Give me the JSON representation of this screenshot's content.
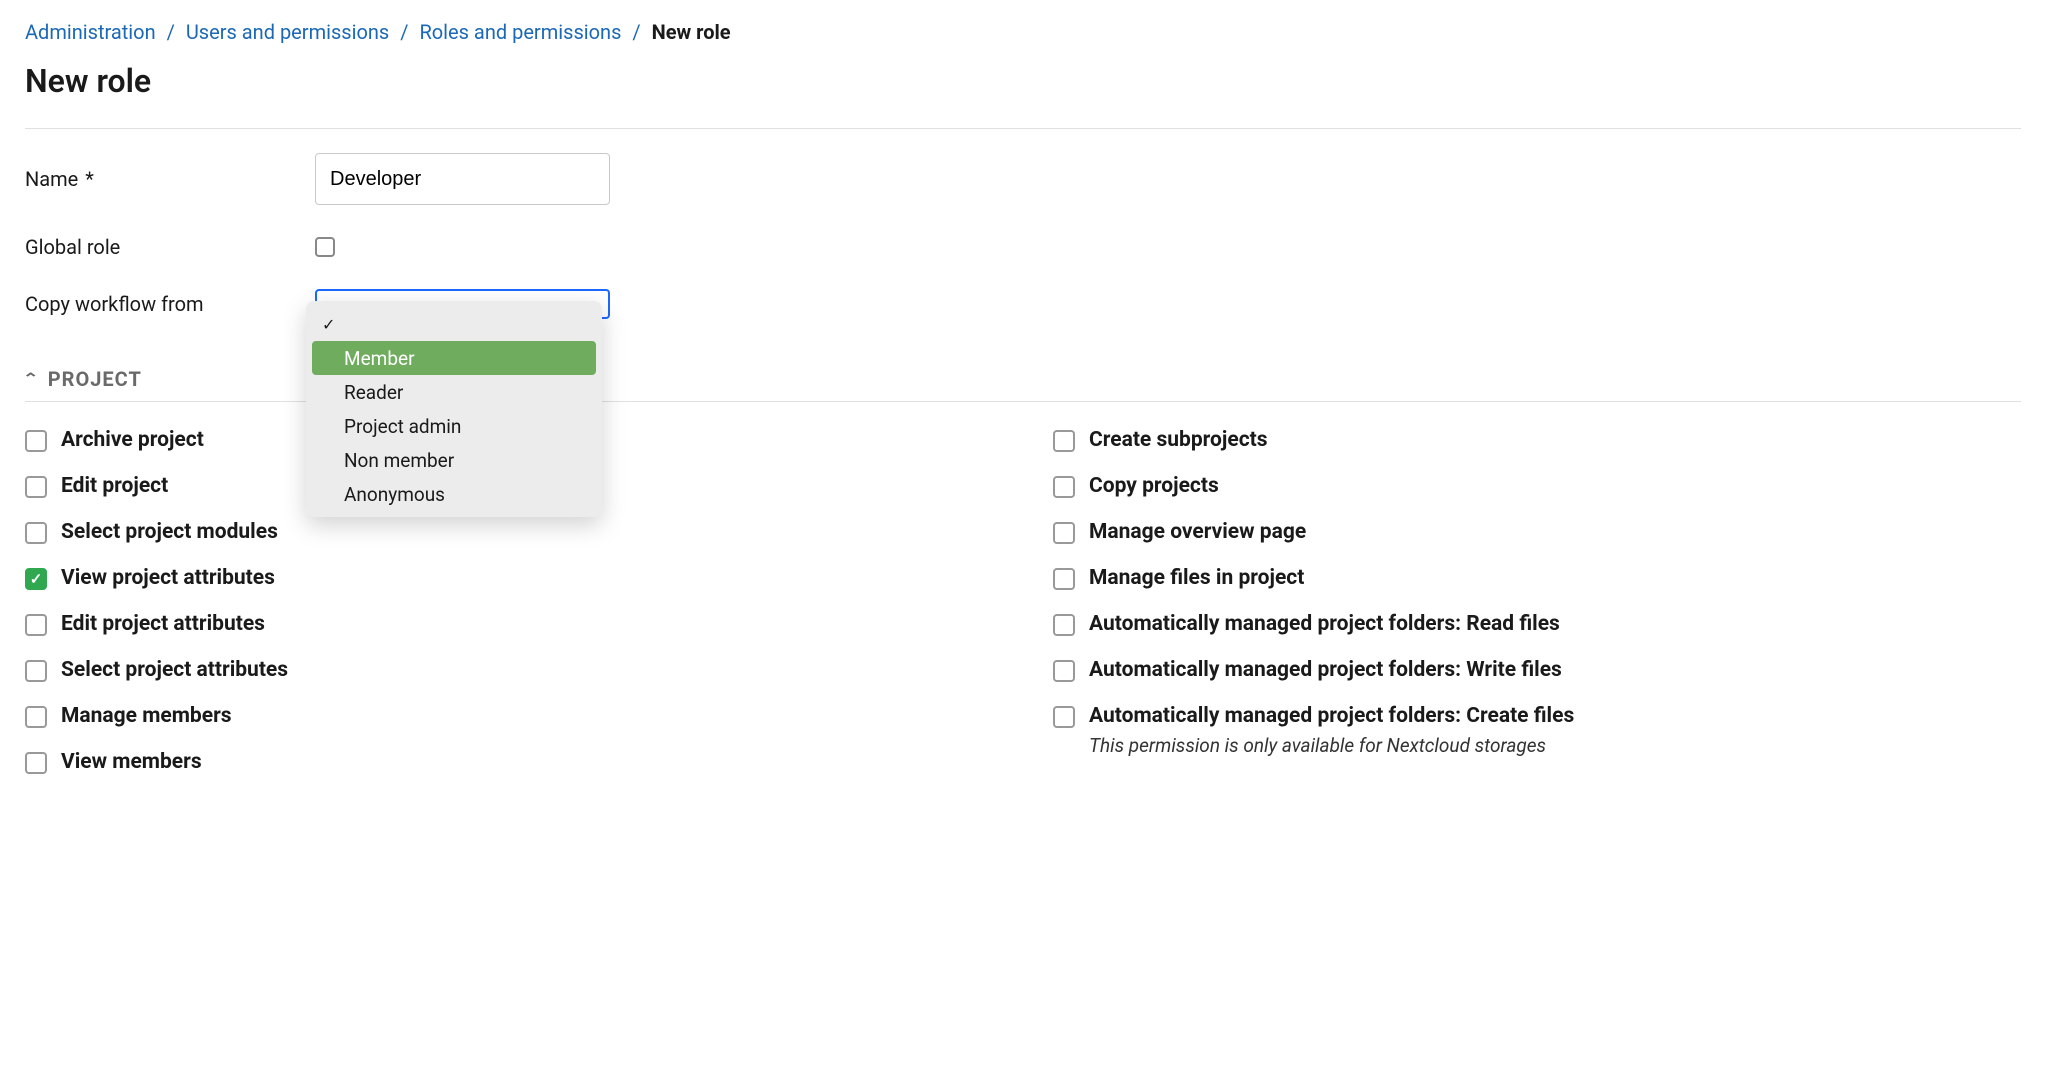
{
  "breadcrumb": {
    "items": [
      {
        "label": "Administration"
      },
      {
        "label": "Users and permissions"
      },
      {
        "label": "Roles and permissions"
      }
    ],
    "current": "New role"
  },
  "page_title": "New role",
  "form": {
    "name_label": "Name",
    "name_required": "*",
    "name_value": "Developer",
    "global_role_label": "Global role",
    "copy_workflow_label": "Copy workflow from",
    "dropdown": {
      "options": [
        {
          "label": "",
          "current": true
        },
        {
          "label": "Member",
          "highlighted": true
        },
        {
          "label": "Reader"
        },
        {
          "label": "Project admin"
        },
        {
          "label": "Non member"
        },
        {
          "label": "Anonymous"
        }
      ]
    }
  },
  "section": {
    "title": "PROJECT"
  },
  "permissions": {
    "left": [
      {
        "label": "Archive project",
        "checked": false
      },
      {
        "label": "Edit project",
        "checked": false
      },
      {
        "label": "Select project modules",
        "checked": false
      },
      {
        "label": "View project attributes",
        "checked": true
      },
      {
        "label": "Edit project attributes",
        "checked": false
      },
      {
        "label": "Select project attributes",
        "checked": false
      },
      {
        "label": "Manage members",
        "checked": false
      },
      {
        "label": "View members",
        "checked": false
      }
    ],
    "right": [
      {
        "label": "Create subprojects",
        "checked": false
      },
      {
        "label": "Copy projects",
        "checked": false
      },
      {
        "label": "Manage overview page",
        "checked": false
      },
      {
        "label": "Manage files in project",
        "checked": false
      },
      {
        "label": "Automatically managed project folders: Read files",
        "checked": false
      },
      {
        "label": "Automatically managed project folders: Write files",
        "checked": false
      },
      {
        "label": "Automatically managed project folders: Create files",
        "checked": false,
        "note": "This permission is only available for Nextcloud storages"
      }
    ]
  }
}
